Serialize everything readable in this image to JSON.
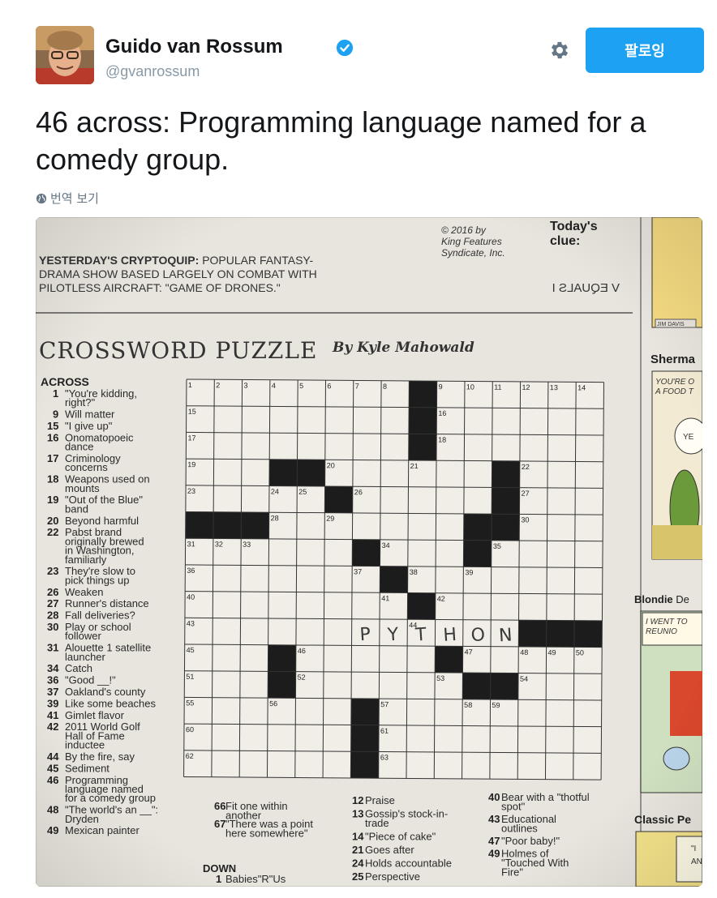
{
  "tweet": {
    "author_name": "Guido van Rossum",
    "author_handle": "@gvanrossum",
    "follow_label": "팔로잉",
    "text": "46 across: Programming language named for a comedy group.",
    "translate_label": "번역 보기"
  },
  "photo": {
    "copyright": [
      "© 2016 by",
      "King Features",
      "Syndicate, Inc."
    ],
    "todays_clue": [
      "Today's",
      "clue:"
    ],
    "clue_mirrored": "V EQUALS I",
    "cryptoquip": [
      {
        "bold": "YESTERDAY'S CRYPTOQUIP:",
        "text": " POPULAR FANTASY-"
      },
      {
        "bold": "",
        "text": "DRAMA SHOW BASED LARGELY ON COMBAT WITH"
      },
      {
        "bold": "",
        "text": "PILOTLESS AIRCRAFT: \"GAME OF DRONES.\""
      }
    ],
    "puzzle_title": "CROSSWORD PUZZLE",
    "puzzle_byline": "By Kyle Mahowald",
    "across_heading": "ACROSS",
    "across_clues": [
      {
        "n": "1",
        "t": [
          "\"You're kidding,",
          "right?\""
        ]
      },
      {
        "n": "9",
        "t": [
          "Will matter"
        ]
      },
      {
        "n": "15",
        "t": [
          "\"I give up\""
        ]
      },
      {
        "n": "16",
        "t": [
          "Onomatopoeic",
          "dance"
        ]
      },
      {
        "n": "17",
        "t": [
          "Criminology",
          "concerns"
        ]
      },
      {
        "n": "18",
        "t": [
          "Weapons used on",
          "mounts"
        ]
      },
      {
        "n": "19",
        "t": [
          "\"Out of the Blue\"",
          "band"
        ]
      },
      {
        "n": "20",
        "t": [
          "Beyond harmful"
        ]
      },
      {
        "n": "22",
        "t": [
          "Pabst brand",
          "originally brewed",
          "in Washington,",
          "familiarly"
        ]
      },
      {
        "n": "23",
        "t": [
          "They're slow to",
          "pick things up"
        ]
      },
      {
        "n": "26",
        "t": [
          "Weaken"
        ]
      },
      {
        "n": "27",
        "t": [
          "Runner's distance"
        ]
      },
      {
        "n": "28",
        "t": [
          "Fall deliveries?"
        ]
      },
      {
        "n": "30",
        "t": [
          "Play or school",
          "follower"
        ]
      },
      {
        "n": "31",
        "t": [
          "Alouette 1 satellite",
          "launcher"
        ]
      },
      {
        "n": "34",
        "t": [
          "Catch"
        ]
      },
      {
        "n": "36",
        "t": [
          "\"Good __!\""
        ]
      },
      {
        "n": "37",
        "t": [
          "Oakland's county"
        ]
      },
      {
        "n": "39",
        "t": [
          "Like some beaches"
        ]
      },
      {
        "n": "41",
        "t": [
          "Gimlet flavor"
        ]
      },
      {
        "n": "42",
        "t": [
          "2011 World Golf",
          "Hall of Fame",
          "inductee"
        ]
      },
      {
        "n": "44",
        "t": [
          "By the fire, say"
        ]
      },
      {
        "n": "45",
        "t": [
          "Sediment"
        ]
      },
      {
        "n": "46",
        "t": [
          "Programming",
          "language named",
          "for a comedy group"
        ]
      },
      {
        "n": "48",
        "t": [
          "\"The world's an __\":",
          "Dryden"
        ]
      },
      {
        "n": "49",
        "t": [
          "Mexican painter"
        ]
      }
    ],
    "middle_clues": [
      {
        "n": "66",
        "t": [
          "Fit one within",
          "another"
        ]
      },
      {
        "n": "67",
        "t": [
          "\"There was a point",
          "here somewhere\""
        ]
      }
    ],
    "down_heading": "DOWN",
    "down_first": {
      "n": "1",
      "t": [
        "Babies\"R\"Us"
      ]
    },
    "col3_clues": [
      {
        "n": "12",
        "t": [
          "Praise"
        ]
      },
      {
        "n": "13",
        "t": [
          "Gossip's stock-in-",
          "trade"
        ]
      },
      {
        "n": "14",
        "t": [
          "\"Piece of cake\""
        ]
      },
      {
        "n": "21",
        "t": [
          "Goes after"
        ]
      },
      {
        "n": "24",
        "t": [
          "Holds accountable"
        ]
      },
      {
        "n": "25",
        "t": [
          "Perspective"
        ]
      }
    ],
    "col4_clues": [
      {
        "n": "40",
        "t": [
          "Bear with a \"thotful",
          "spot\""
        ]
      },
      {
        "n": "43",
        "t": [
          "Educational",
          "outlines"
        ]
      },
      {
        "n": "47",
        "t": [
          "\"Poor baby!\""
        ]
      },
      {
        "n": "49",
        "t": [
          "Holmes of",
          "\"Touched With",
          "Fire\""
        ]
      }
    ],
    "handwritten": [
      "P",
      "Y",
      "T",
      "H",
      "O",
      "N"
    ],
    "comics": {
      "strip1_sign": "JIM DAVIS",
      "strip2_title": "Sherma",
      "strip2_text": [
        "YOU'RE O",
        "A FOOD T"
      ],
      "strip2_bubble": "YE",
      "strip3_title": "Blondie",
      "strip3_title_rest": "De",
      "strip3_text": [
        "I WENT TO",
        "REUNIO"
      ],
      "strip4_title": "Classic Pe",
      "strip4_text": [
        "\"I",
        "AN"
      ]
    }
  }
}
